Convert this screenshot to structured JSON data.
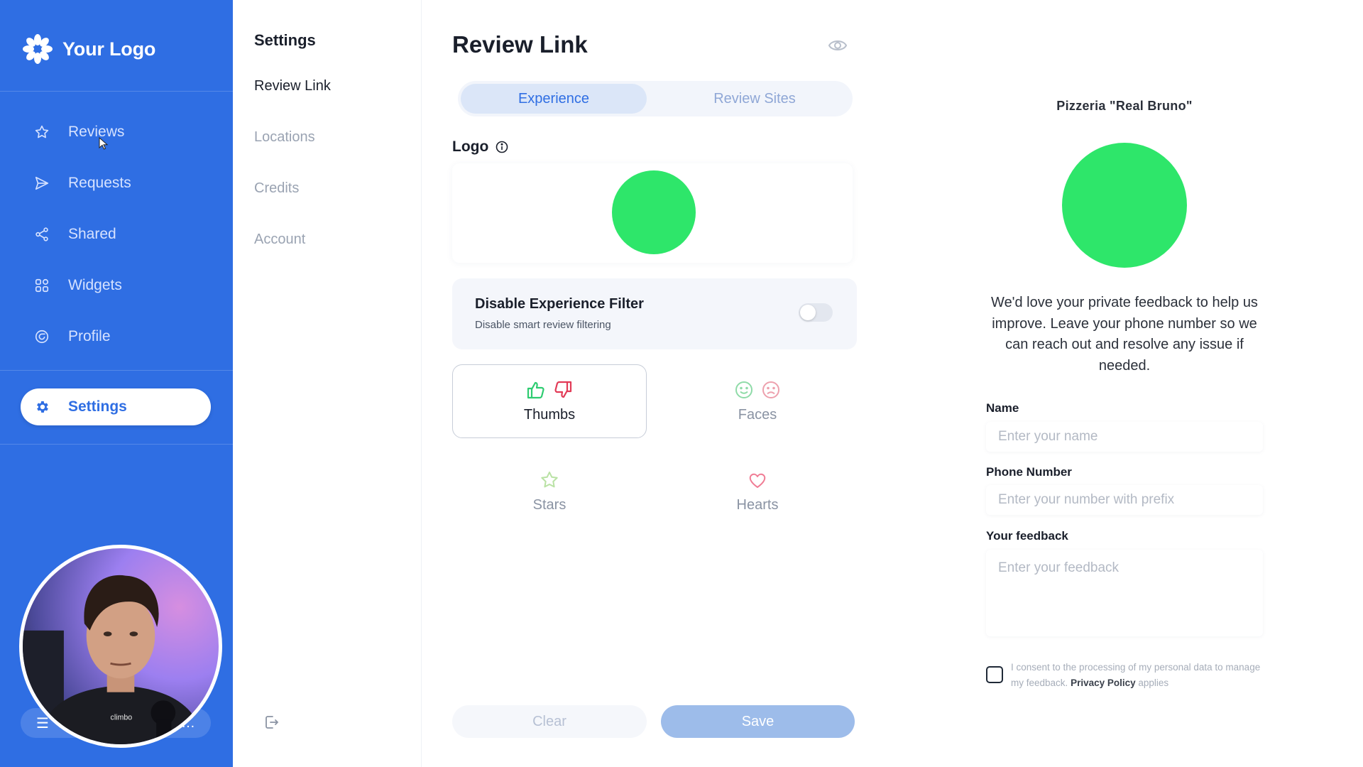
{
  "app": {
    "logo_text": "Your Logo",
    "colors": {
      "primary": "#2f6ee3",
      "accent_green": "#2ee66a",
      "thumb_up": "#2ecc71",
      "thumb_down": "#e23b57"
    }
  },
  "sidebar": {
    "items": [
      {
        "label": "Reviews",
        "icon": "star-icon"
      },
      {
        "label": "Requests",
        "icon": "send-icon"
      },
      {
        "label": "Shared",
        "icon": "share-icon"
      },
      {
        "label": "Widgets",
        "icon": "grid-icon"
      },
      {
        "label": "Profile",
        "icon": "profile-icon"
      }
    ],
    "active": {
      "label": "Settings",
      "icon": "gear-icon"
    }
  },
  "settings_nav": {
    "title": "Settings",
    "items": [
      "Review Link",
      "Locations",
      "Credits",
      "Account"
    ],
    "active_index": 0
  },
  "editor": {
    "title": "Review Link",
    "tabs": [
      "Experience",
      "Review Sites"
    ],
    "active_tab": 0,
    "logo_label": "Logo",
    "filter": {
      "title": "Disable Experience Filter",
      "subtitle": "Disable smart review filtering",
      "enabled": false
    },
    "options": [
      {
        "label": "Thumbs",
        "selected": true
      },
      {
        "label": "Faces",
        "selected": false
      },
      {
        "label": "Stars",
        "selected": false
      },
      {
        "label": "Hearts",
        "selected": false
      }
    ],
    "clear_label": "Clear",
    "save_label": "Save"
  },
  "preview": {
    "business_name": "Pizzeria \"Real Bruno\"",
    "message": "We'd love your private feedback to help us improve. Leave your phone number so we can reach out and resolve any issue if needed.",
    "name_label": "Name",
    "name_placeholder": "Enter your name",
    "phone_label": "Phone Number",
    "phone_placeholder": "Enter your number with prefix",
    "feedback_label": "Your feedback",
    "feedback_placeholder": "Enter your feedback",
    "consent_prefix": "I consent to the processing of my personal data to manage my feedback.",
    "consent_link": "Privacy Policy",
    "consent_suffix": "applies"
  }
}
